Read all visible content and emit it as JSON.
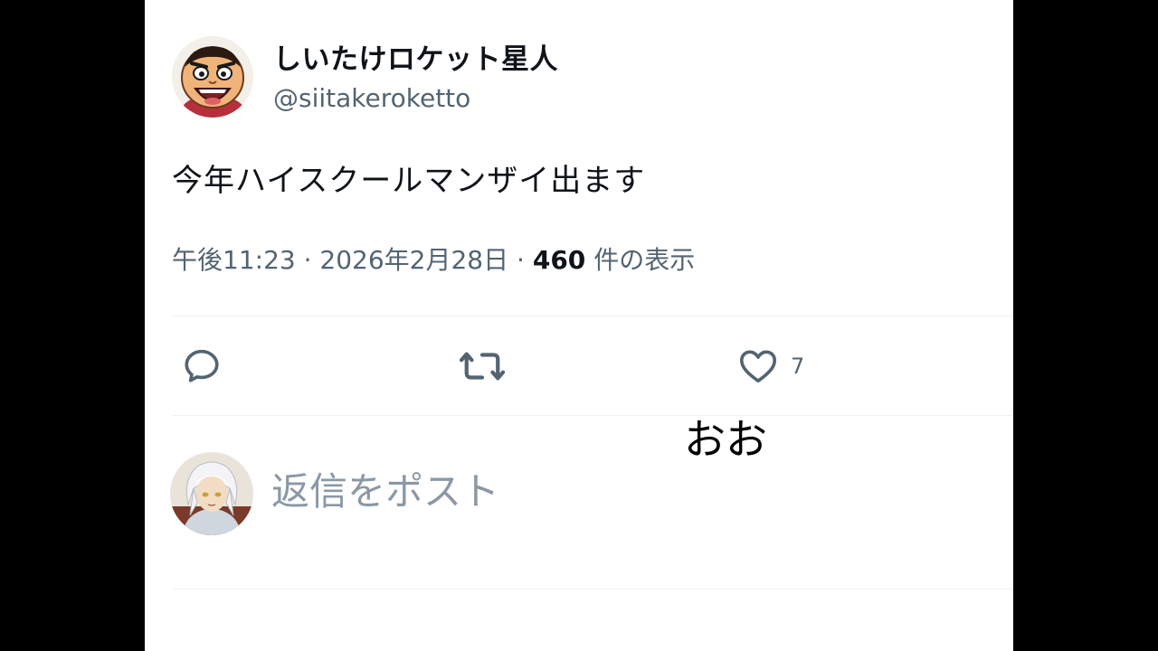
{
  "post": {
    "display_name": "しいたけロケット星人",
    "handle": "@siitakeroketto",
    "text": "今年ハイスクールマンザイ出ます",
    "time": "午後11:23",
    "separator": "·",
    "date": "2026年2月28日",
    "views_count": "460",
    "views_label": "件の表示"
  },
  "actions": {
    "reply_icon": "speech-bubble-icon",
    "repost_icon": "repost-arrows-icon",
    "like_icon": "heart-icon",
    "like_count": "7"
  },
  "caption": "おお",
  "reply": {
    "placeholder": "返信をポスト"
  },
  "colors": {
    "text_primary": "#0f1419",
    "text_secondary": "#536471",
    "divider": "#eff3f4",
    "background": "#ffffff",
    "letterbox": "#000000"
  }
}
